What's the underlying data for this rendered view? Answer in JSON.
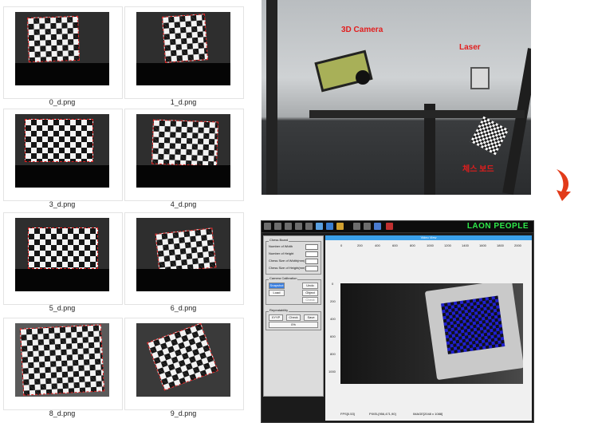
{
  "thumbnails": [
    {
      "filename": "0_d.png"
    },
    {
      "filename": "1_d.png"
    },
    {
      "filename": "3_d.png"
    },
    {
      "filename": "4_d.png"
    },
    {
      "filename": "5_d.png"
    },
    {
      "filename": "6_d.png"
    },
    {
      "filename": "8_d.png"
    },
    {
      "filename": "9_d.png"
    }
  ],
  "photo": {
    "camera_label": "3D Camera",
    "laser_label": "Laser",
    "board_label": "체스 보드"
  },
  "app": {
    "brand": "LAON PEOPLE",
    "toolbar_icons": [
      "cursor-icon",
      "save-icon",
      "settings-icon",
      "grid-icon",
      "filter-icon",
      "target-icon",
      "stop-icon",
      "camera-icon",
      "image-icon",
      "chart-icon",
      "video-icon",
      "record-icon"
    ],
    "chess_board": {
      "title": "Chess Board",
      "fields": [
        "Number of Width",
        "Number of Height",
        "Chess Size of Width(mm)",
        "Chess Size of Height(mm)"
      ]
    },
    "camera_calibration": {
      "title": "Camera Calibration",
      "buttons": [
        "Snapshot",
        "Undo",
        "Load",
        "Object",
        "Check"
      ]
    },
    "repeatability": {
      "title": "Repeatability",
      "buttons": [
        "XYYP",
        "Check",
        "Save"
      ],
      "progress_text": "0%"
    },
    "video_view": {
      "title": "Video View",
      "x_ticks": [
        "0",
        "200",
        "400",
        "600",
        "800",
        "1000",
        "1200",
        "1400",
        "1600",
        "1800",
        "2000"
      ],
      "y_ticks": [
        "0",
        "200",
        "400",
        "600",
        "800",
        "1000"
      ]
    },
    "status": {
      "fps": "FPS[0.53]",
      "pixel": "PIXEL[956,471,90]",
      "image": "IMAGE[2048 x 1088]"
    },
    "colors": {
      "brand": "#2ee84a",
      "accent": "#3aa0ea",
      "board_overlay": "#2020d0",
      "annotation": "#e21d1d"
    }
  }
}
